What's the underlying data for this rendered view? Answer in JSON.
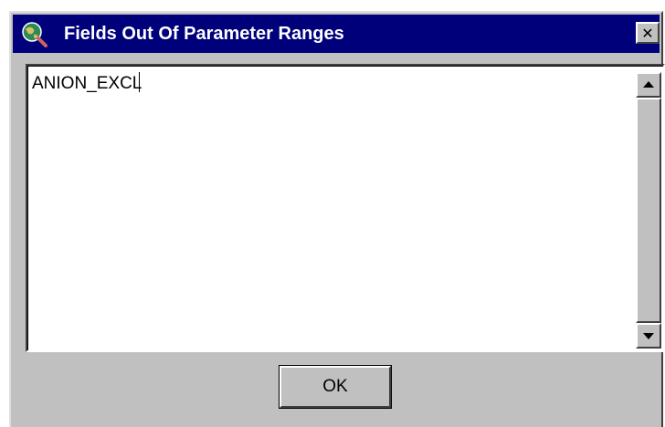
{
  "window": {
    "title": "Fields Out Of Parameter Ranges",
    "title_bar_color": "#00007b",
    "icon": "globe-magnifier-icon",
    "close_label": "✕"
  },
  "list": {
    "items": [
      {
        "label": "ANION_EXCL"
      }
    ]
  },
  "buttons": {
    "ok_label": "OK"
  }
}
